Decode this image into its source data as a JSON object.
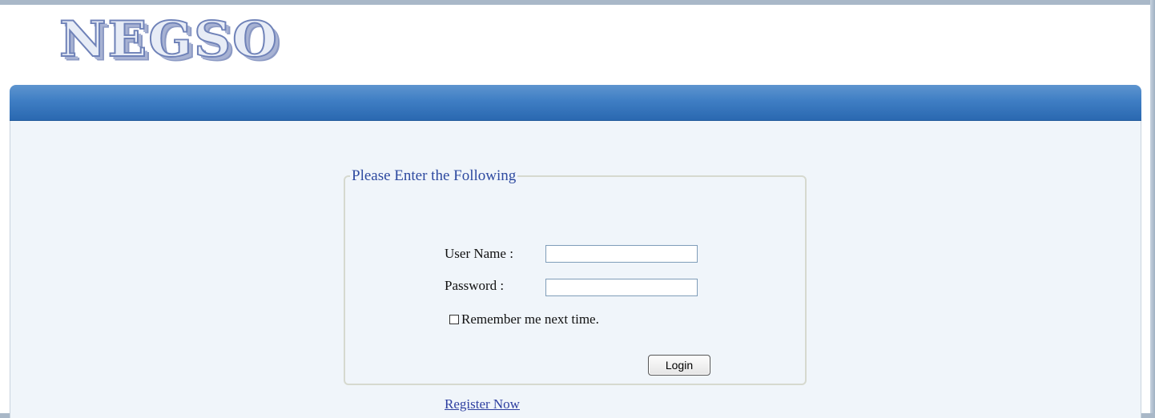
{
  "header": {
    "logo_text": "NEGSO"
  },
  "login": {
    "legend": "Please Enter the Following",
    "username_label": "User Name :",
    "username_value": "",
    "password_label": "Password :",
    "password_value": "",
    "remember_label": "Remember me next time.",
    "remember_checked": false,
    "login_button": "Login",
    "register_link": "Register Now"
  },
  "colors": {
    "header_bar": "#3f7ec4",
    "content_bg": "#f0f5fa",
    "legend_text": "#2e4aa0",
    "link": "#2e3fa0"
  }
}
